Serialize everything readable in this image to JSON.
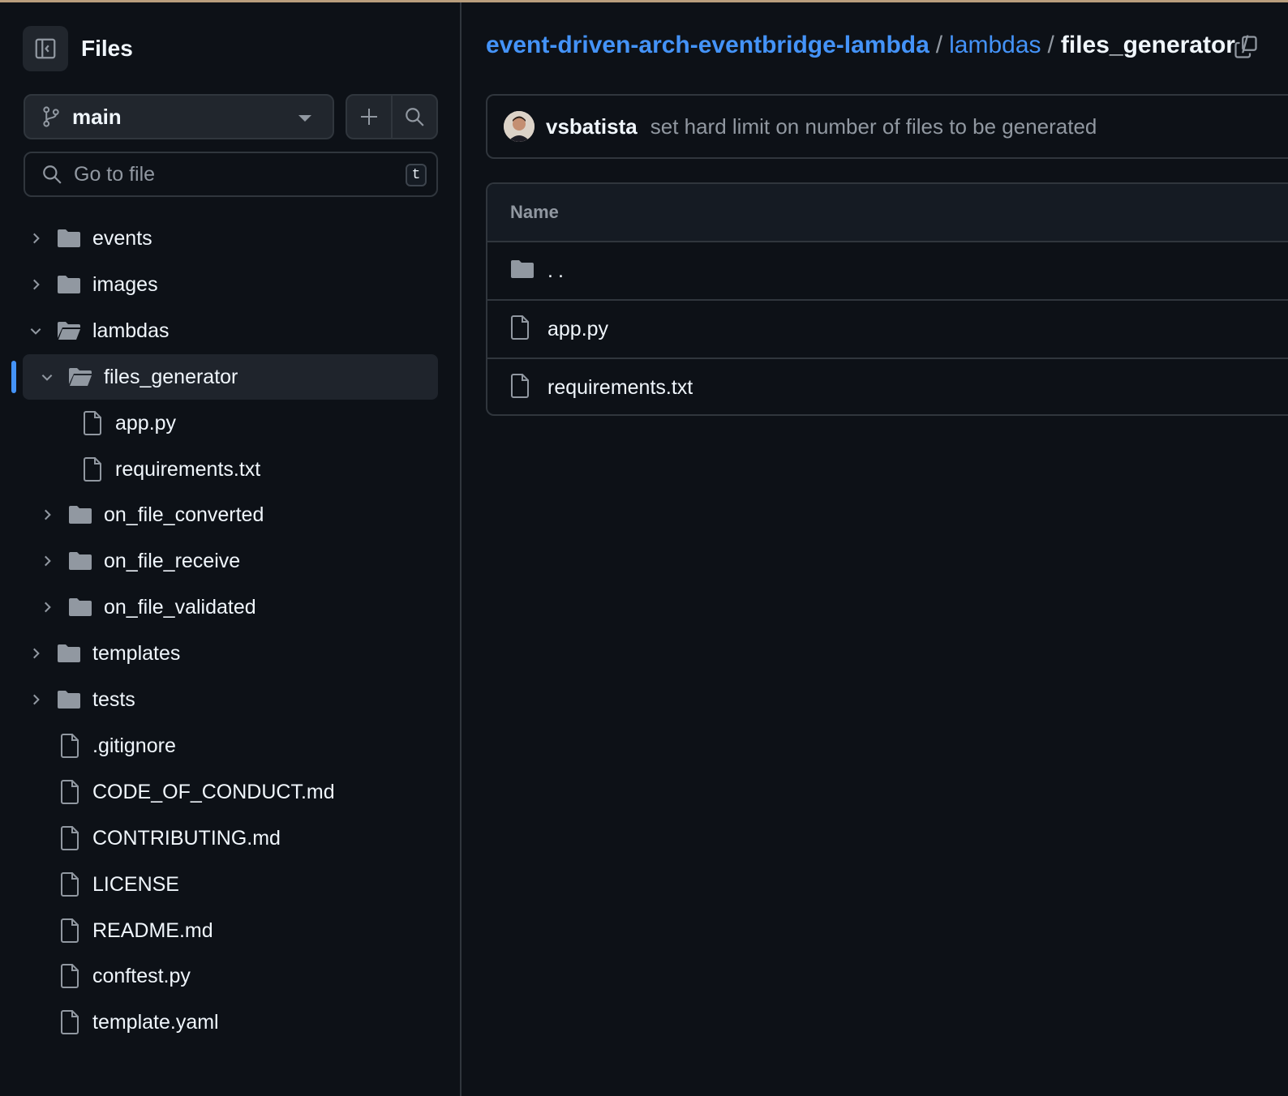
{
  "sidebar": {
    "title": "Files",
    "branch": "main",
    "search_placeholder": "Go to file",
    "search_shortcut": "t",
    "tree": [
      {
        "label": "events",
        "type": "folder",
        "expanded": false,
        "depth": 0
      },
      {
        "label": "images",
        "type": "folder",
        "expanded": false,
        "depth": 0
      },
      {
        "label": "lambdas",
        "type": "folder",
        "expanded": true,
        "depth": 0
      },
      {
        "label": "files_generator",
        "type": "folder",
        "expanded": true,
        "depth": 1,
        "selected": true
      },
      {
        "label": "app.py",
        "type": "file",
        "depth": 2
      },
      {
        "label": "requirements.txt",
        "type": "file",
        "depth": 2
      },
      {
        "label": "on_file_converted",
        "type": "folder",
        "expanded": false,
        "depth": 1
      },
      {
        "label": "on_file_receive",
        "type": "folder",
        "expanded": false,
        "depth": 1
      },
      {
        "label": "on_file_validated",
        "type": "folder",
        "expanded": false,
        "depth": 1
      },
      {
        "label": "templates",
        "type": "folder",
        "expanded": false,
        "depth": 0
      },
      {
        "label": "tests",
        "type": "folder",
        "expanded": false,
        "depth": 0
      },
      {
        "label": ".gitignore",
        "type": "file",
        "depth": 0
      },
      {
        "label": "CODE_OF_CONDUCT.md",
        "type": "file",
        "depth": 0
      },
      {
        "label": "CONTRIBUTING.md",
        "type": "file",
        "depth": 0
      },
      {
        "label": "LICENSE",
        "type": "file",
        "depth": 0
      },
      {
        "label": "README.md",
        "type": "file",
        "depth": 0
      },
      {
        "label": "conftest.py",
        "type": "file",
        "depth": 0
      },
      {
        "label": "template.yaml",
        "type": "file",
        "depth": 0
      }
    ]
  },
  "breadcrumb": {
    "repo": "event-driven-arch-eventbridge-lambda",
    "folder": "lambdas",
    "current": "files_generator",
    "separator": "/"
  },
  "commit": {
    "author": "vsbatista",
    "message": "set hard limit on number of files to be generated"
  },
  "table": {
    "header": "Name",
    "rows": [
      {
        "label": "..",
        "type": "folder"
      },
      {
        "label": "app.py",
        "type": "file"
      },
      {
        "label": "requirements.txt",
        "type": "file"
      }
    ]
  },
  "colors": {
    "background": "#0d1117",
    "link": "#4493f8",
    "border": "#30363d",
    "muted": "#9198a1",
    "icon": "#9198a1"
  },
  "icons": {
    "collapse": "sidebar-collapse-icon",
    "branch": "git-branch-icon",
    "add": "plus-icon",
    "search": "search-icon",
    "copy": "copy-icon",
    "folder": "folder-icon",
    "folder_open": "folder-open-icon",
    "file": "file-icon"
  }
}
